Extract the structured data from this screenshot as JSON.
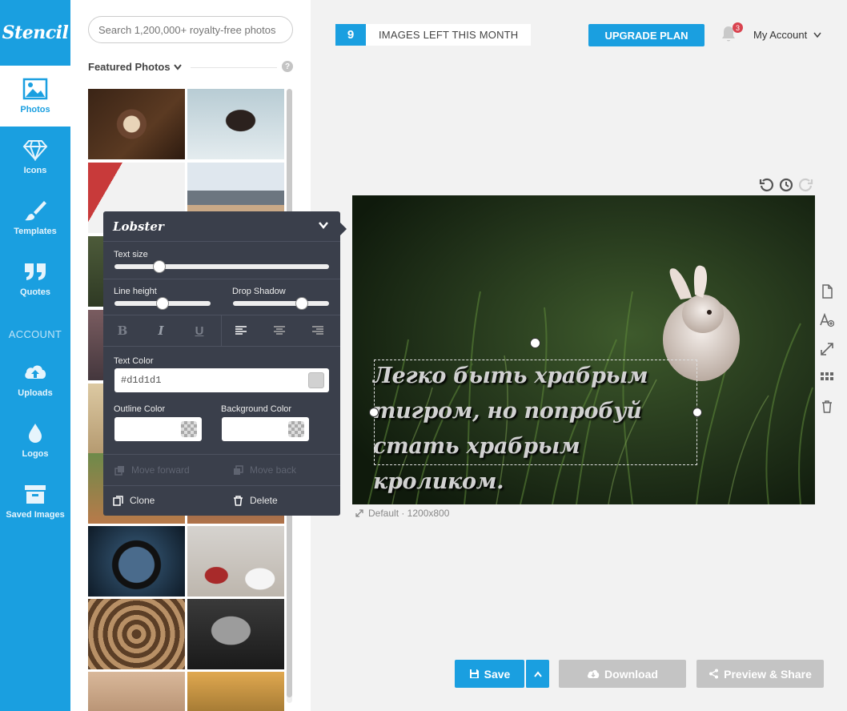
{
  "app": {
    "logo": "Stencil"
  },
  "nav": {
    "items": [
      {
        "label": "Photos",
        "icon": "image-icon",
        "active": true
      },
      {
        "label": "Icons",
        "icon": "diamond-icon"
      },
      {
        "label": "Templates",
        "icon": "brush-icon"
      },
      {
        "label": "Quotes",
        "icon": "quote-icon"
      }
    ],
    "section_label": "ACCOUNT",
    "account_items": [
      {
        "label": "Uploads",
        "icon": "cloud-upload-icon"
      },
      {
        "label": "Logos",
        "icon": "drop-icon"
      },
      {
        "label": "Saved Images",
        "icon": "archive-icon"
      }
    ]
  },
  "photos_panel": {
    "search_placeholder": "Search 1,200,000+ royalty-free photos",
    "section_title": "Featured Photos"
  },
  "text_editor": {
    "font": "Lobster",
    "text_size_label": "Text size",
    "text_size_value": 0.2,
    "line_height_label": "Line height",
    "line_height_value": 0.5,
    "drop_shadow_label": "Drop Shadow",
    "drop_shadow_value": 0.72,
    "format_buttons": [
      "B",
      "I",
      "U"
    ],
    "text_color_label": "Text Color",
    "text_color": "#d1d1d1",
    "outline_color_label": "Outline Color",
    "background_color_label": "Background Color",
    "move_forward": "Move forward",
    "move_back": "Move back",
    "clone": "Clone",
    "delete": "Delete"
  },
  "topbar": {
    "images_left_count": "9",
    "images_left_text": "IMAGES LEFT THIS MONTH",
    "upgrade_label": "UPGRADE PLAN",
    "notification_count": "3",
    "account_label": "My Account"
  },
  "canvas": {
    "quote_text": "Легко быть храбрым\nтигром, но попробуй\nстать храбрым кроликом.",
    "size_label": "Default · 1200x800"
  },
  "actions": {
    "save": "Save",
    "download": "Download",
    "preview_share": "Preview & Share"
  },
  "colors": {
    "brand": "#1a9fe0",
    "editor_bg": "#3a3f4b",
    "disabled_button": "#c4c4c4"
  }
}
